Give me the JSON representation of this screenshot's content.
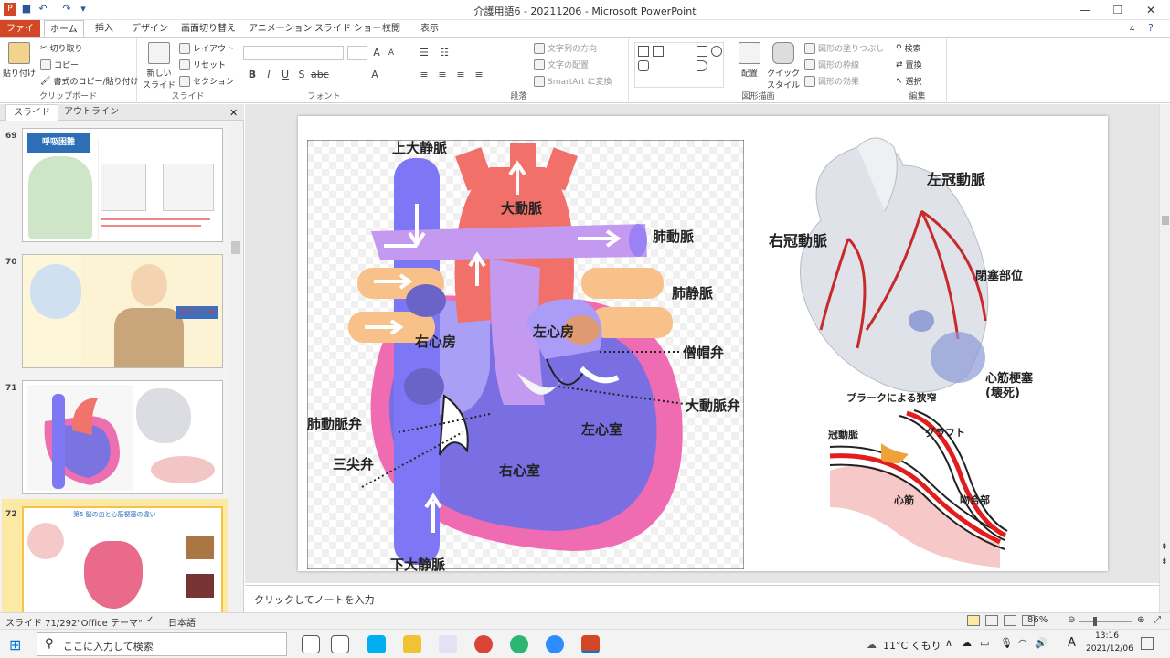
{
  "window": {
    "title": "介護用語6 - 20211206 - Microsoft PowerPoint"
  },
  "tabs": [
    "ファイル",
    "ホーム",
    "挿入",
    "デザイン",
    "画面切り替え",
    "アニメーション",
    "スライド ショー",
    "校閲",
    "表示"
  ],
  "ribbon": {
    "clipboard": {
      "paste": "貼り付け",
      "cut": "切り取り",
      "copy": "コピー",
      "format_painter": "書式のコピー/貼り付け",
      "label": "クリップボード"
    },
    "slides": {
      "new_slide": "新しい\nスライド",
      "layout": "レイアウト",
      "reset": "リセット",
      "section": "セクション",
      "label": "スライド"
    },
    "font": {
      "label": "フォント"
    },
    "paragraph": {
      "text_direction": "文字列の方向",
      "align_text": "文字の配置",
      "smartart": "SmartArt に変換",
      "label": "段落"
    },
    "drawing": {
      "arrange": "配置",
      "quick_styles": "クイック\nスタイル",
      "shape_fill": "図形の塗りつぶし",
      "shape_outline": "図形の枠線",
      "shape_effects": "図形の効果",
      "label": "図形描画"
    },
    "editing": {
      "find": "検索",
      "replace": "置換",
      "select": "選択",
      "label": "編集"
    }
  },
  "panel": {
    "tab_slides": "スライド",
    "tab_outline": "アウトライン",
    "slide_numbers": [
      "69",
      "70",
      "71",
      "72"
    ],
    "thumb70_label": "チアノーゼ",
    "thumb69_title": "呼吸困難",
    "thumb72_title": "第5 脳の血と心筋梗塞の違い"
  },
  "slide": {
    "heart_labels": [
      "上大静脈",
      "大動脈",
      "肺動脈",
      "肺静脈",
      "左心房",
      "右心房",
      "僧帽弁",
      "大動脈弁",
      "肺動脈弁",
      "左心室",
      "三尖弁",
      "右心室",
      "下大静脈"
    ],
    "coronary_labels": {
      "left": "左冠動脈",
      "right": "右冠動脈",
      "occlusion": "閉塞部位",
      "infarct": "心筋梗塞\n(壊死)"
    },
    "graft_labels": {
      "title": "プラークによる狭窄",
      "coronary": "冠動脈",
      "graft": "グラフト",
      "muscle": "心筋",
      "anastomosis": "吻合部"
    }
  },
  "notes": {
    "placeholder": "クリックしてノートを入力"
  },
  "status": {
    "slide": "スライド 71/292",
    "theme": "\"Office テーマ\"",
    "lang": "日本語",
    "zoom": "86%"
  },
  "taskbar": {
    "search": "ここに入力して検索",
    "weather": "11°C くもり",
    "time": "13:16",
    "date": "2021/12/06",
    "ime": "A"
  },
  "colors": {
    "file_tab": "#d24726",
    "selected_thumb": "#f6c342"
  }
}
